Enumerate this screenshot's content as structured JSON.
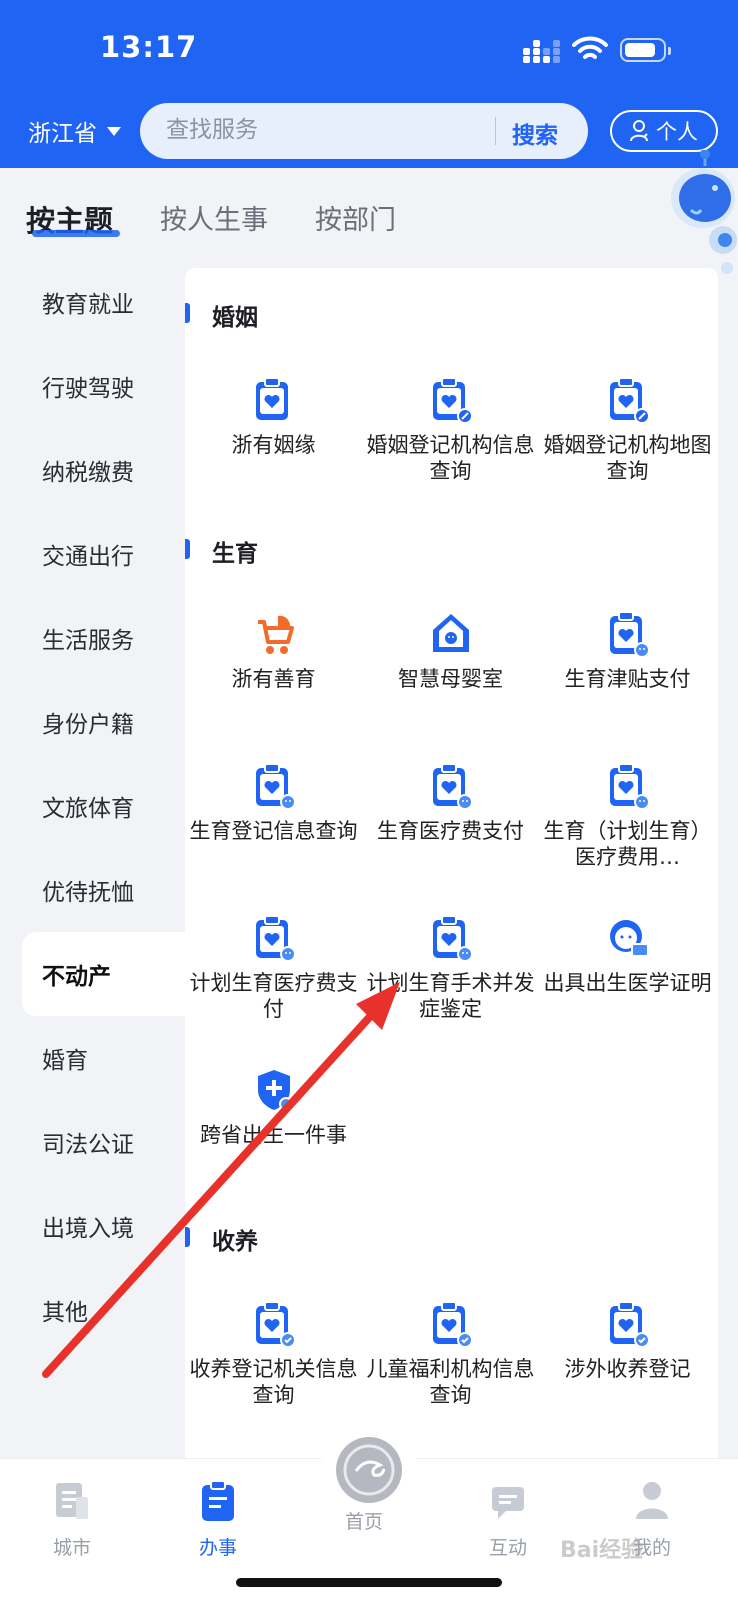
{
  "status_bar": {
    "time": "13:17"
  },
  "header": {
    "province": "浙江省",
    "search": {
      "placeholder": "查找服务",
      "button": "搜索"
    },
    "personal_button": "个人"
  },
  "category_tabs": [
    {
      "label": "按主题",
      "active": true
    },
    {
      "label": "按人生事",
      "active": false
    },
    {
      "label": "按部门",
      "active": false
    }
  ],
  "sidebar": {
    "items": [
      {
        "label": "教育就业"
      },
      {
        "label": "行驶驾驶"
      },
      {
        "label": "纳税缴费"
      },
      {
        "label": "交通出行"
      },
      {
        "label": "生活服务"
      },
      {
        "label": "身份户籍"
      },
      {
        "label": "文旅体育"
      },
      {
        "label": "优待抚恤"
      },
      {
        "label": "不动产",
        "active": true
      },
      {
        "label": "婚育"
      },
      {
        "label": "司法公证"
      },
      {
        "label": "出境入境"
      },
      {
        "label": "其他"
      }
    ]
  },
  "sections": [
    {
      "title": "婚姻",
      "services": [
        {
          "label": "浙有姻缘",
          "icon": "clipboard-heart-icon"
        },
        {
          "label": "婚姻登记机构信息查询",
          "icon": "clipboard-heart-badge-icon"
        },
        {
          "label": "婚姻登记机构地图查询",
          "icon": "clipboard-heart-badge-icon"
        }
      ]
    },
    {
      "title": "生育",
      "services": [
        {
          "label": "浙有善育",
          "icon": "stroller-icon"
        },
        {
          "label": "智慧母婴室",
          "icon": "house-baby-icon"
        },
        {
          "label": "生育津贴支付",
          "icon": "clipboard-baby-icon"
        },
        {
          "label": "生育登记信息查询",
          "icon": "clipboard-baby-icon"
        },
        {
          "label": "生育医疗费支付",
          "icon": "clipboard-baby-icon"
        },
        {
          "label": "生育（计划生育）医疗费用…",
          "icon": "clipboard-baby-icon"
        },
        {
          "label": "计划生育医疗费支付",
          "icon": "clipboard-baby-icon"
        },
        {
          "label": "计划生育手术并发症鉴定",
          "icon": "clipboard-baby-icon"
        },
        {
          "label": "出具出生医学证明",
          "icon": "baby-certificate-icon"
        },
        {
          "label": "跨省出生一件事",
          "icon": "shield-plus-icon"
        }
      ]
    },
    {
      "title": "收养",
      "services": [
        {
          "label": "收养登记机关信息查询",
          "icon": "clipboard-heart-check-icon"
        },
        {
          "label": "儿童福利机构信息查询",
          "icon": "clipboard-heart-check-icon"
        },
        {
          "label": "涉外收养登记",
          "icon": "clipboard-heart-check-icon"
        }
      ]
    }
  ],
  "bottom_nav": [
    {
      "label": "城市",
      "icon": "city-doc-icon"
    },
    {
      "label": "办事",
      "icon": "task-doc-icon",
      "active": true
    },
    {
      "label": "首页",
      "icon": "home-logo-icon"
    },
    {
      "label": "互动",
      "icon": "chat-icon"
    },
    {
      "label": "我的",
      "icon": "user-icon"
    }
  ],
  "watermark": "Bai经验",
  "colors": {
    "brand_blue": "#1f64f2",
    "panel_bg": "#f2f3f7",
    "annotation_red": "#e8312b",
    "icon_orange": "#f26b2a"
  }
}
